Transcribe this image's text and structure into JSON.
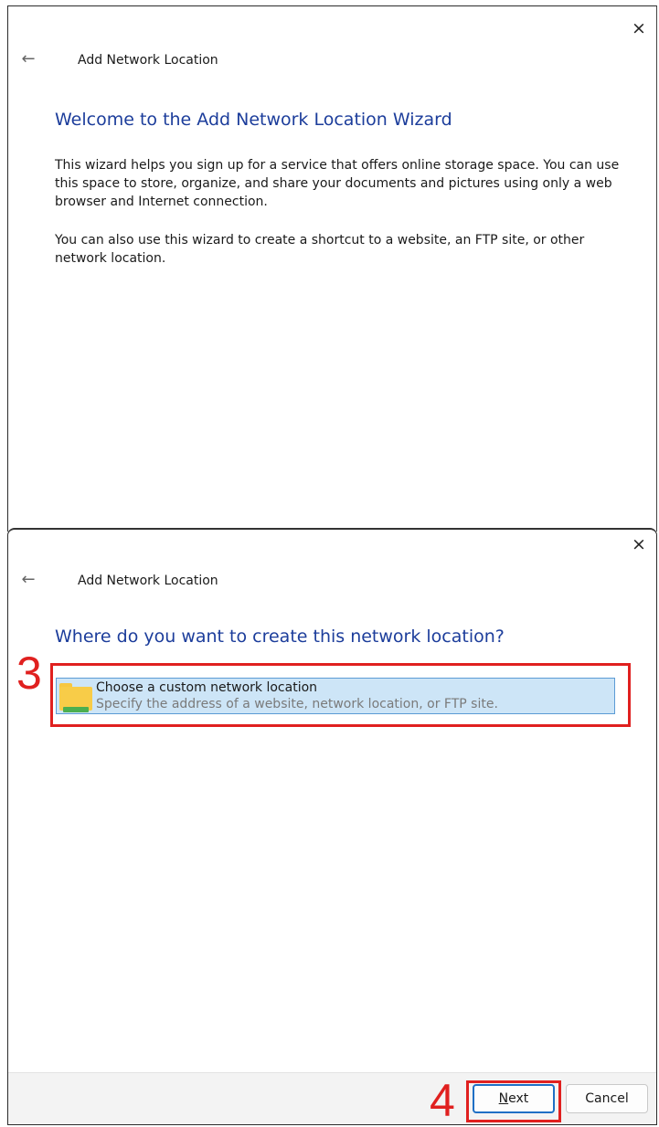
{
  "window1": {
    "close_glyph": "×",
    "back_glyph": "←",
    "title": "Add Network Location",
    "heading": "Welcome to the Add Network Location Wizard",
    "paragraph1": "This wizard helps you sign up for a service that offers online storage space.  You can use this space to store, organize, and share your documents and pictures using only a web browser and Internet connection.",
    "paragraph2": "You can also use this wizard to create a shortcut to a website, an FTP site, or other network location."
  },
  "window2": {
    "close_glyph": "×",
    "back_glyph": "←",
    "title": "Add Network Location",
    "heading": "Where do you want to create this network location?",
    "option": {
      "title": "Choose a custom network location",
      "description": "Specify the address of a website, network location, or FTP site."
    },
    "buttons": {
      "next_mnemonic": "N",
      "next_rest": "ext",
      "cancel": "Cancel"
    }
  },
  "annotations": {
    "step3": "3",
    "step4": "4"
  },
  "colors": {
    "heading": "#1c3d9b",
    "selection_fill": "#cde5f7",
    "selection_border": "#5b9bd5",
    "annotation": "#e0201f"
  }
}
